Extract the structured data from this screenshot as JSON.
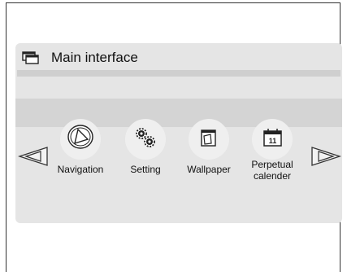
{
  "title": "Main interface",
  "icons": {
    "title": "windows-stack-icon",
    "prev": "arrow-left-icon",
    "next": "arrow-right-icon"
  },
  "menu": [
    {
      "label": "Navigation",
      "icon": "navigation-icon"
    },
    {
      "label": "Setting",
      "icon": "gears-icon"
    },
    {
      "label": "Wallpaper",
      "icon": "wallpaper-icon"
    },
    {
      "label": "Perpetual calender",
      "icon": "calendar-icon",
      "badge": "11"
    }
  ],
  "colors": {
    "panel": "#e5e5e5",
    "band": "#d4d4d4",
    "strip": "#cfcfcf",
    "bubble": "#efefef"
  }
}
